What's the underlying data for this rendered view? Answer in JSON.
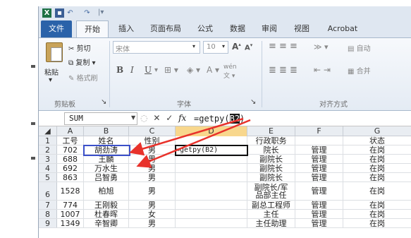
{
  "app": {
    "icon": "excel-icon",
    "tabs": [
      {
        "label": "文件"
      },
      {
        "label": "开始"
      },
      {
        "label": "插入"
      },
      {
        "label": "页面布局"
      },
      {
        "label": "公式"
      },
      {
        "label": "数据"
      },
      {
        "label": "审阅"
      },
      {
        "label": "视图"
      },
      {
        "label": "Acrobat"
      }
    ]
  },
  "ribbon": {
    "clipboard": {
      "paste": "粘贴",
      "cut": "剪切",
      "copy": "复制",
      "format_painter": "格式刷",
      "group": "剪贴板"
    },
    "font": {
      "name": "宋体",
      "size": "10",
      "grow": "A",
      "shrink": "A",
      "bold": "B",
      "italic": "I",
      "underline": "U",
      "wen": "wén",
      "group": "字体"
    },
    "alignment": {
      "group": "对齐方式",
      "wrap": "自动",
      "merge": "合并"
    }
  },
  "formula_bar": {
    "name_box": "SUM",
    "fx": "fx",
    "formula_prefix": "=getpy(",
    "formula_ref": "B2",
    "formula_suffix": ")"
  },
  "sheet": {
    "columns": [
      "A",
      "B",
      "C",
      "D",
      "E",
      "F",
      "G"
    ],
    "active_column": "D",
    "rows": [
      {
        "num": "1",
        "A": "工号",
        "B": "姓名",
        "C": "性别",
        "D": "",
        "E": "行政职务",
        "F": "",
        "G": "状态"
      },
      {
        "num": "2",
        "A": "702",
        "B": "胡劲涛",
        "C": "男",
        "D": "=getpy(B2)",
        "E": "院长",
        "F": "管理",
        "G": "在岗"
      },
      {
        "num": "3",
        "A": "688",
        "B": "王麟",
        "C": "男",
        "D": "",
        "E": "副院长",
        "F": "管理",
        "G": "在岗"
      },
      {
        "num": "4",
        "A": "692",
        "B": "万水生",
        "C": "男",
        "D": "",
        "E": "副院长",
        "F": "管理",
        "G": "在岗"
      },
      {
        "num": "5",
        "A": "863",
        "B": "吕智勇",
        "C": "男",
        "D": "",
        "E": "副院长",
        "F": "管理",
        "G": "在岗"
      },
      {
        "num": "6",
        "A": "1528",
        "B": "柏旭",
        "C": "男",
        "D": "",
        "E": "副院长/军\n品部主任",
        "F": "管理",
        "G": "在岗"
      },
      {
        "num": "7",
        "A": "774",
        "B": "王刚毅",
        "C": "男",
        "D": "",
        "E": "副总工程师",
        "F": "管理",
        "G": "在岗"
      },
      {
        "num": "8",
        "A": "1007",
        "B": "杜春晖",
        "C": "女",
        "D": "",
        "E": "主任",
        "F": "管理",
        "G": "在岗"
      },
      {
        "num": "9",
        "A": "1349",
        "B": "辛智卿",
        "C": "男",
        "D": "",
        "E": "主任助理",
        "F": "管理",
        "G": "在岗"
      }
    ]
  },
  "annotation_color": "#e8322b"
}
